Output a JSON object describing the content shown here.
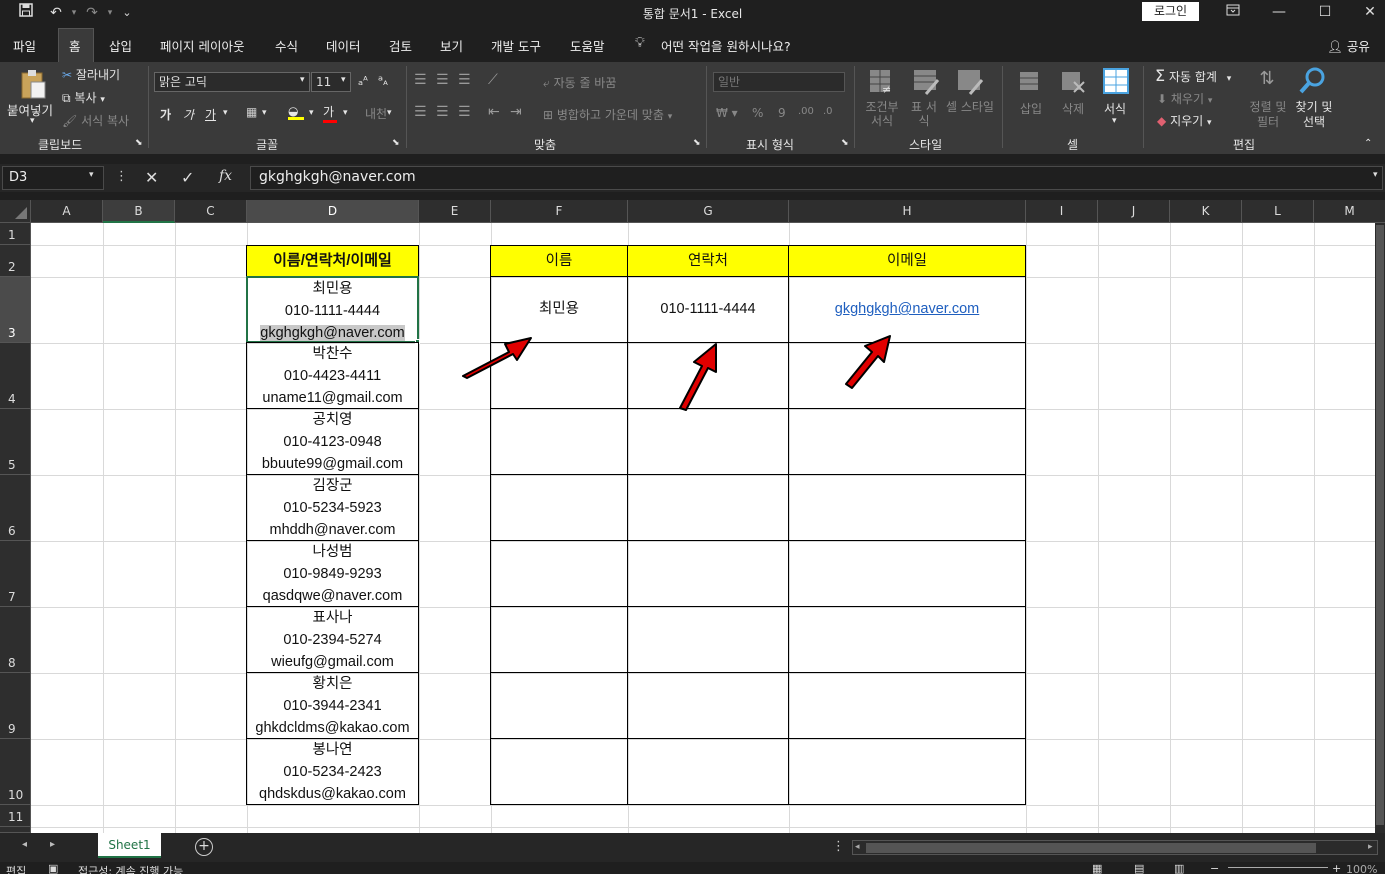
{
  "titlebar": {
    "title": "통합 문서1  -  Excel",
    "login_label": "로그인",
    "qat": {
      "save_icon": "save-icon",
      "undo_icon": "undo-icon",
      "redo_icon": "redo-icon",
      "customize_icon": "chevron-down-icon"
    },
    "window": {
      "display_options": "ribbon-display-icon",
      "minimize": "minimize-icon",
      "maximize": "maximize-icon",
      "close": "close-icon"
    }
  },
  "menu": {
    "tabs": [
      "파일",
      "홈",
      "삽입",
      "페이지 레이아웃",
      "수식",
      "데이터",
      "검토",
      "보기",
      "개발 도구",
      "도움말"
    ],
    "active_tab": "홈",
    "tell_me": "어떤 작업을 원하시나요?",
    "share": "공유"
  },
  "ribbon": {
    "clipboard": {
      "paste": "붙여넣기",
      "cut": "잘라내기",
      "copy": "복사",
      "format_painter": "서식 복사",
      "label": "클립보드"
    },
    "font": {
      "name": "맑은 고딕",
      "size": "11",
      "label": "글꼴",
      "bold": "가",
      "italic": "가",
      "underline": "가",
      "font_color_glyph": "가"
    },
    "alignment": {
      "wrap": "자동 줄 바꿈",
      "merge": "병합하고 가운데 맞춤",
      "label": "맞춤"
    },
    "number": {
      "format": "일반",
      "label": "표시 형식"
    },
    "styles": {
      "conditional": "조건부 서식",
      "table": "표 서식",
      "cell_styles": "셀 스타일",
      "label": "스타일"
    },
    "cells": {
      "insert": "삽입",
      "delete": "삭제",
      "format": "서식",
      "label": "셀"
    },
    "editing": {
      "autosum": "자동 합계",
      "fill": "채우기",
      "clear": "지우기",
      "sort": "정렬 및 필터",
      "find": "찾기 및 선택",
      "label": "편집"
    }
  },
  "formula_bar": {
    "name_box": "D3",
    "content": "gkghgkgh@naver.com"
  },
  "columns": [
    "A",
    "B",
    "C",
    "D",
    "E",
    "F",
    "G",
    "H",
    "I",
    "J",
    "K",
    "L",
    "M"
  ],
  "rows": [
    "1",
    "2",
    "3",
    "4",
    "5",
    "6",
    "7",
    "8",
    "9",
    "10",
    "11"
  ],
  "selected_cell": "D3",
  "sheet": {
    "combined_header": "이름/연락처/이메일",
    "combined": [
      {
        "name": "최민용",
        "phone": "010-1111-4444",
        "email": "gkghgkgh@naver.com"
      },
      {
        "name": "박찬수",
        "phone": "010-4423-4411",
        "email": "uname11@gmail.com"
      },
      {
        "name": "공치영",
        "phone": "010-4123-0948",
        "email": "bbuute99@gmail.com"
      },
      {
        "name": "김장군",
        "phone": "010-5234-5923",
        "email": "mhddh@naver.com"
      },
      {
        "name": "나성범",
        "phone": "010-9849-9293",
        "email": "qasdqwe@naver.com"
      },
      {
        "name": "표사나",
        "phone": "010-2394-5274",
        "email": "wieufg@gmail.com"
      },
      {
        "name": "황치은",
        "phone": "010-3944-2341",
        "email": "ghkdcldms@kakao.com"
      },
      {
        "name": "봉나연",
        "phone": "010-5234-2423",
        "email": "qhdskdus@kakao.com"
      }
    ],
    "split_headers": [
      "이름",
      "연락처",
      "이메일"
    ],
    "split_row1": {
      "name": "최민용",
      "phone": "010-1111-4444",
      "email": "gkghgkgh@naver.com"
    }
  },
  "sheet_tabs": {
    "tabs": [
      "Sheet1"
    ],
    "active": "Sheet1"
  },
  "status": {
    "mode": "편집",
    "accessibility": "접근성: 계속 진행 가능",
    "zoom": "100%"
  },
  "colors": {
    "header_fill": "#ffff00",
    "selection": "#217346",
    "link": "#1f5fbf",
    "arrow": "#e00000"
  }
}
